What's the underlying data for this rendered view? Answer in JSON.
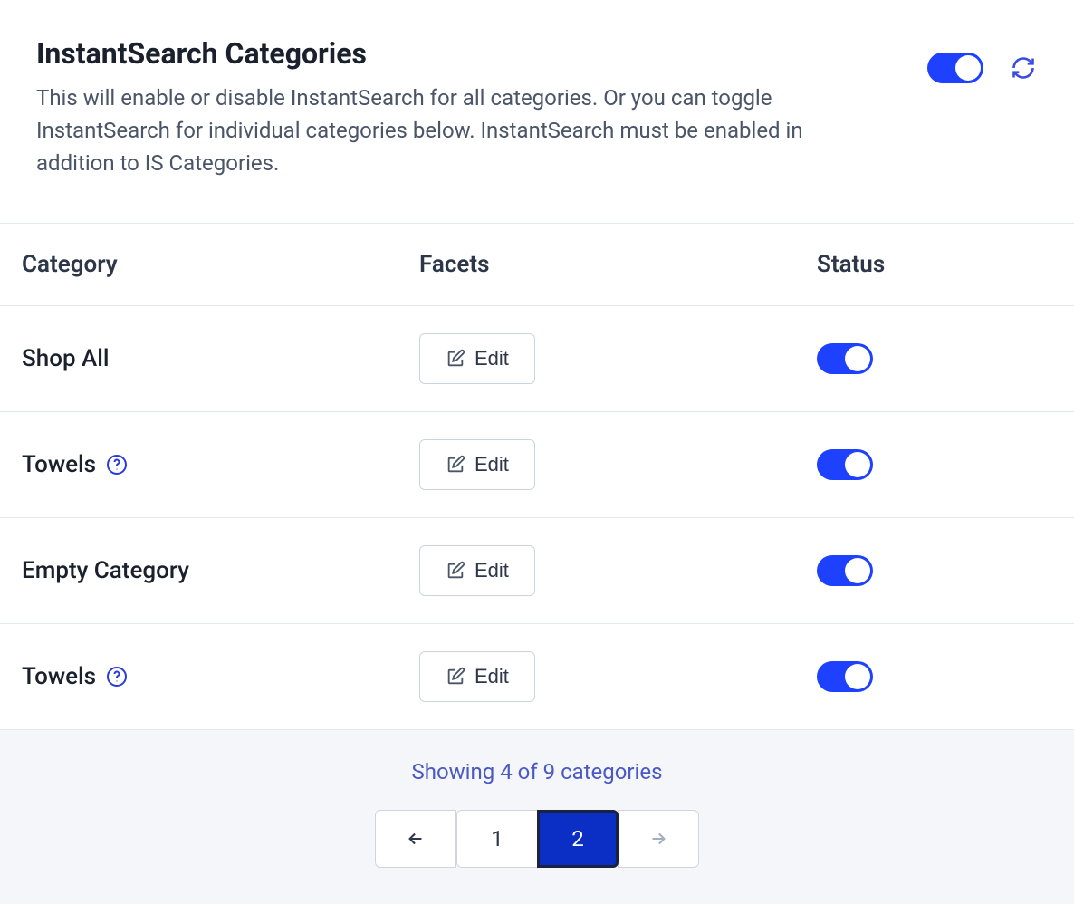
{
  "header": {
    "title": "InstantSearch Categories",
    "description": "This will enable or disable InstantSearch for all categories. Or you can toggle InstantSearch for individual categories below. InstantSearch must be enabled in addition to IS Categories.",
    "master_toggle": true
  },
  "table": {
    "columns": {
      "category": "Category",
      "facets": "Facets",
      "status": "Status"
    },
    "edit_label": "Edit",
    "rows": [
      {
        "name": "Shop All",
        "has_help": false,
        "status": true
      },
      {
        "name": "Towels",
        "has_help": true,
        "status": true
      },
      {
        "name": "Empty Category",
        "has_help": false,
        "status": true
      },
      {
        "name": "Towels",
        "has_help": true,
        "status": true
      }
    ]
  },
  "pagination": {
    "summary": "Showing 4 of 9 categories",
    "pages": [
      "1",
      "2"
    ],
    "current": "2",
    "prev_enabled": true,
    "next_enabled": false
  }
}
